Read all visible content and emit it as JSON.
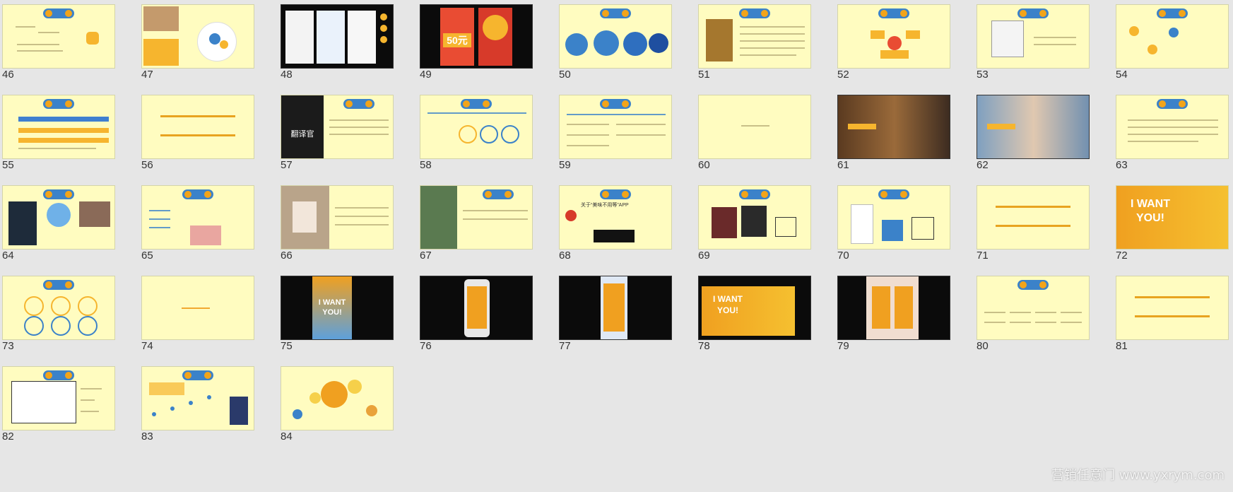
{
  "slides": [
    {
      "number": "46"
    },
    {
      "number": "47"
    },
    {
      "number": "48"
    },
    {
      "number": "49"
    },
    {
      "number": "50"
    },
    {
      "number": "51"
    },
    {
      "number": "52"
    },
    {
      "number": "53"
    },
    {
      "number": "54"
    },
    {
      "number": "55"
    },
    {
      "number": "56"
    },
    {
      "number": "57"
    },
    {
      "number": "58"
    },
    {
      "number": "59"
    },
    {
      "number": "60"
    },
    {
      "number": "61"
    },
    {
      "number": "62"
    },
    {
      "number": "63"
    },
    {
      "number": "64"
    },
    {
      "number": "65"
    },
    {
      "number": "66"
    },
    {
      "number": "67"
    },
    {
      "number": "68"
    },
    {
      "number": "69"
    },
    {
      "number": "70"
    },
    {
      "number": "71"
    },
    {
      "number": "72"
    },
    {
      "number": "73"
    },
    {
      "number": "74"
    },
    {
      "number": "75"
    },
    {
      "number": "76"
    },
    {
      "number": "77"
    },
    {
      "number": "78"
    },
    {
      "number": "79"
    },
    {
      "number": "80"
    },
    {
      "number": "81"
    },
    {
      "number": "82"
    },
    {
      "number": "83"
    },
    {
      "number": "84"
    }
  ],
  "thumb_text": {
    "s48_price": "50元",
    "s57_title": "翻译官",
    "s68_title": "关于“美味不用等”APP",
    "s72_text": "I WANT YOU!",
    "s75_text": "I WANT YOU!",
    "s78_text": "I WANT YOU!"
  },
  "watermark": "营销任意门 www.yxrym.com",
  "colors": {
    "background": "#e6e6e6",
    "slide": "#fffcc0",
    "accent_orange": "#e8a320",
    "accent_blue": "#3b82c9"
  }
}
